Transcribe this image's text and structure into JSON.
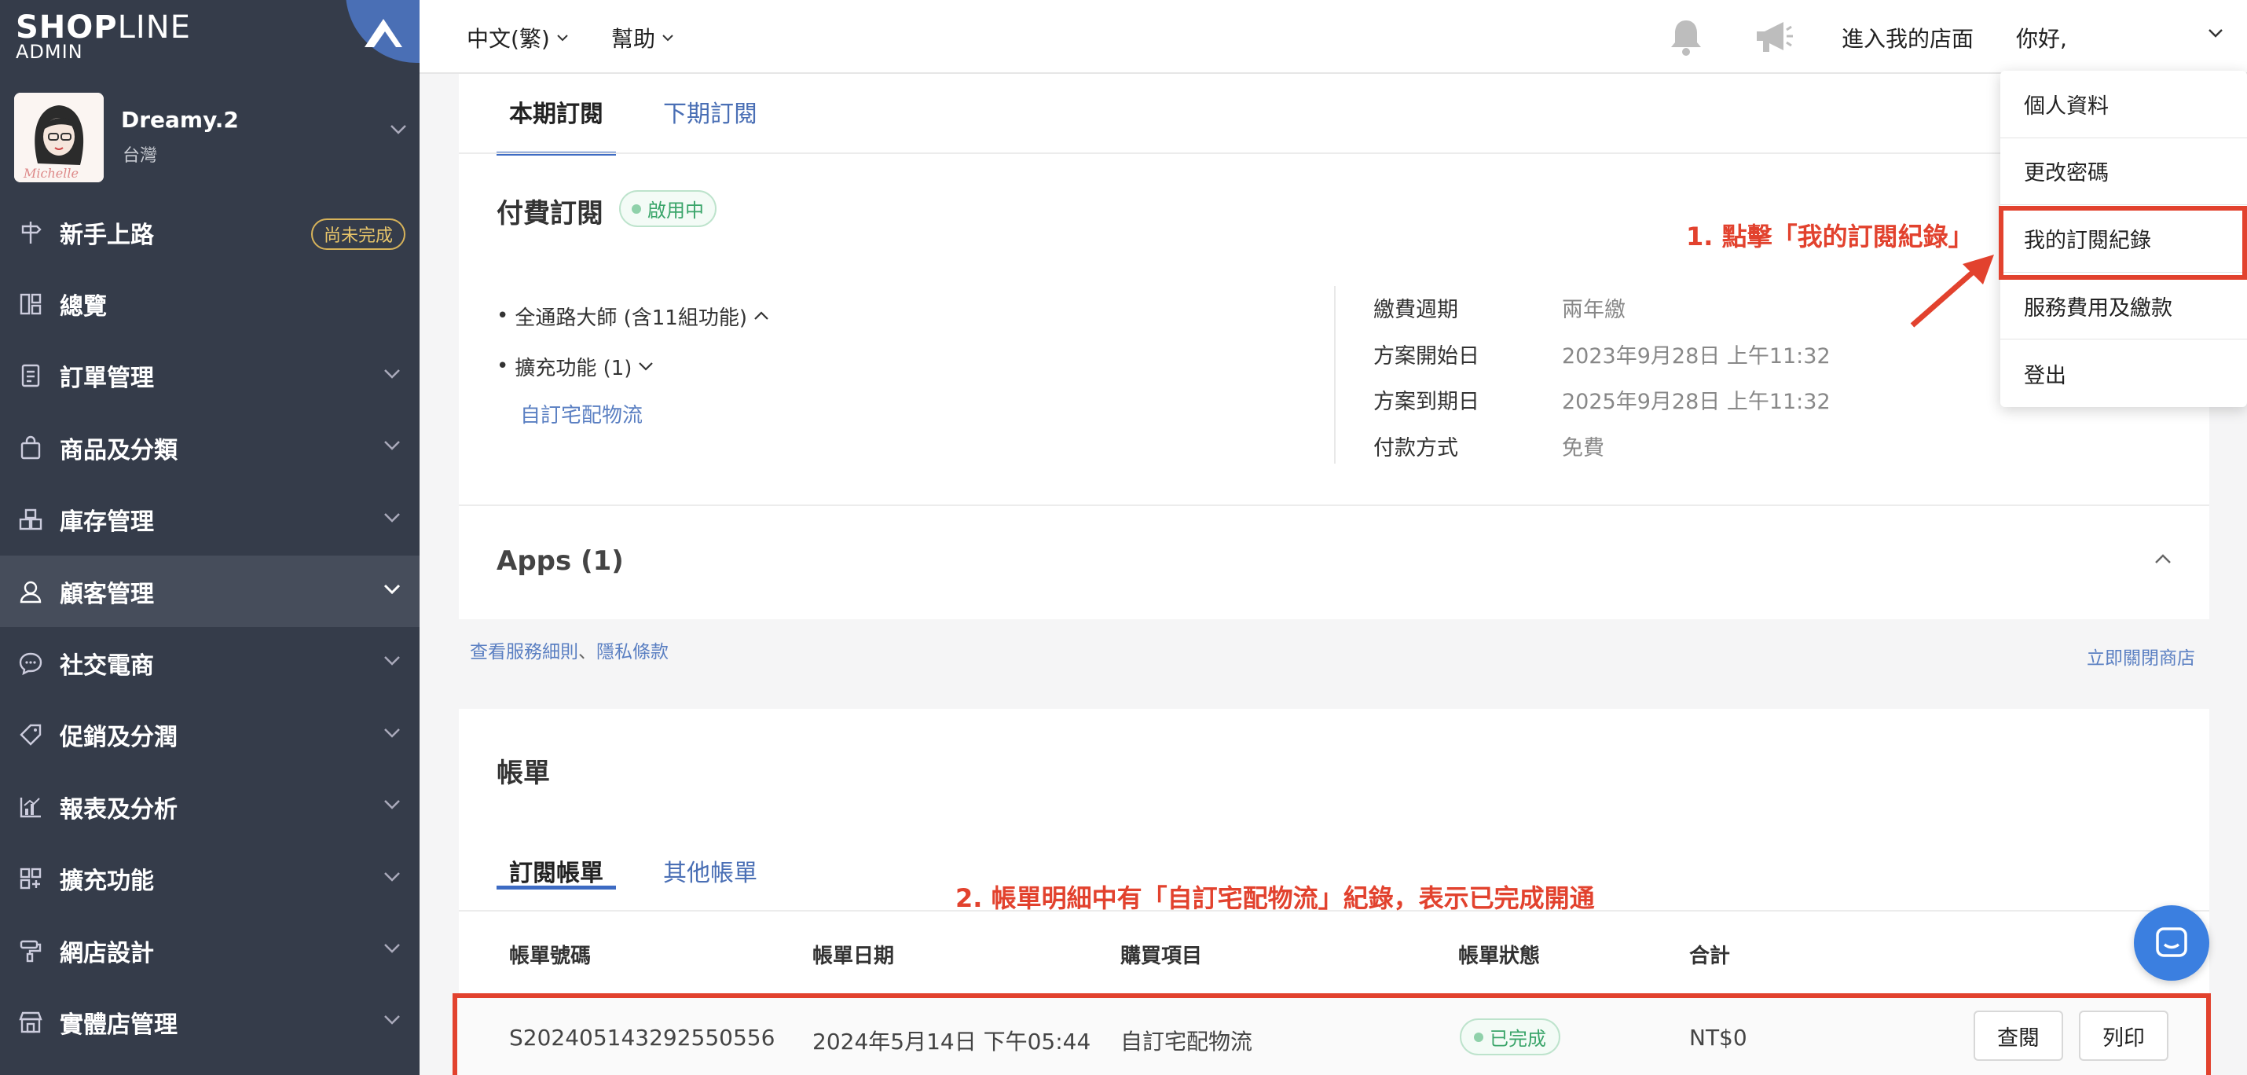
{
  "brand": {
    "logo_bold": "SHOP",
    "logo_thin": "LINE",
    "logo_sub": "ADMIN"
  },
  "profile": {
    "name": "Dreamy.2",
    "region": "台灣"
  },
  "sidebar": {
    "items": [
      {
        "label": "新手上路",
        "icon": "signpost-icon",
        "badge": "尚未完成"
      },
      {
        "label": "總覽",
        "icon": "dashboard-icon"
      },
      {
        "label": "訂單管理",
        "icon": "order-icon"
      },
      {
        "label": "商品及分類",
        "icon": "shopping-bag-icon"
      },
      {
        "label": "庫存管理",
        "icon": "inventory-icon"
      },
      {
        "label": "顧客管理",
        "icon": "user-icon"
      },
      {
        "label": "社交電商",
        "icon": "chat-bubble-icon"
      },
      {
        "label": "促銷及分潤",
        "icon": "tag-icon"
      },
      {
        "label": "報表及分析",
        "icon": "chart-icon"
      },
      {
        "label": "擴充功能",
        "icon": "apps-grid-icon"
      },
      {
        "label": "網店設計",
        "icon": "paint-roller-icon"
      },
      {
        "label": "實體店管理",
        "icon": "store-icon"
      }
    ]
  },
  "topbar": {
    "language": "中文(繁)",
    "help": "幫助",
    "store": "進入我的店面",
    "hello": "你好,"
  },
  "dropdown": {
    "items": [
      "個人資料",
      "更改密碼",
      "我的訂閱紀錄",
      "服務費用及繳款",
      "登出"
    ]
  },
  "subscription": {
    "tabs": [
      "本期訂閱",
      "下期訂閱"
    ],
    "paid_title": "付費訂閱",
    "status": "啟用中",
    "plan": "全通路大師 (含11組功能)",
    "addons": "擴充功能 (1)",
    "addon_item": "自訂宅配物流",
    "details": [
      {
        "key": "繳費週期",
        "value": "兩年繳"
      },
      {
        "key": "方案開始日",
        "value": "2023年9月28日 上午11:32"
      },
      {
        "key": "方案到期日",
        "value": "2025年9月28日 上午11:32"
      },
      {
        "key": "付款方式",
        "value": "免費"
      }
    ],
    "apps_title": "Apps (1)"
  },
  "links": {
    "terms": "查看服務細則",
    "separator": "、",
    "privacy": "隱私條款",
    "close_shop": "立即關閉商店"
  },
  "bill": {
    "title": "帳單",
    "tabs": [
      "訂閱帳單",
      "其他帳單"
    ],
    "headers": [
      "帳單號碼",
      "帳單日期",
      "購買項目",
      "帳單狀態",
      "合計"
    ],
    "row": {
      "number": "S202405143292550556",
      "date": "2024年5月14日 下午05:44",
      "item": "自訂宅配物流",
      "status": "已完成",
      "total": "NT$0",
      "view_btn": "查閱",
      "print_btn": "列印"
    }
  },
  "annotations": {
    "step1": "1. 點擊「我的訂閱紀錄」",
    "step2": "2. 帳單明細中有「自訂宅配物流」紀錄，表示已完成開通"
  },
  "colors": {
    "sidebar_bg": "#353c4a",
    "accent_blue": "#3d6bc3",
    "annotation_red": "#e2422e",
    "success_green": "#3aa56a"
  }
}
